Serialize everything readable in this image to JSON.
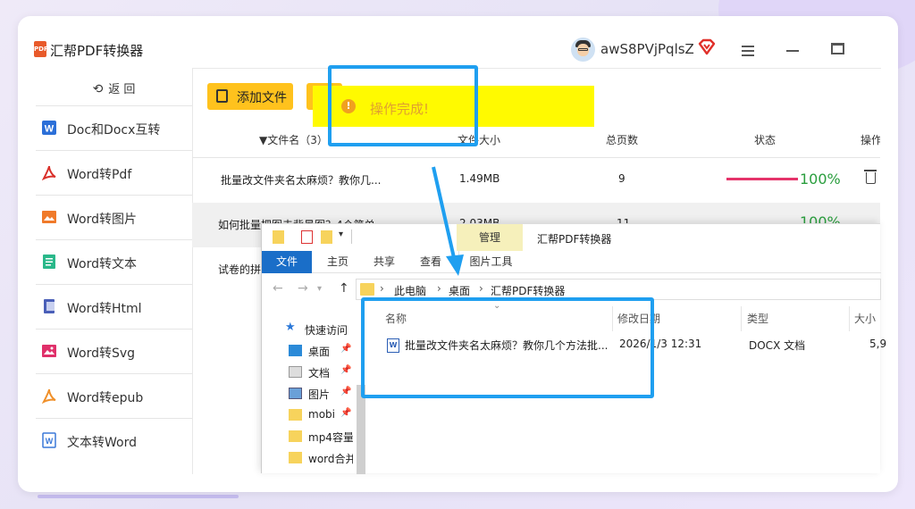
{
  "app": {
    "title": "汇帮PDF转换器",
    "logo_text": "PDF",
    "username": "awS8PVjPqlsZ"
  },
  "sidebar": {
    "back_label": "返  回",
    "items": [
      {
        "label": "Doc和Docx互转",
        "icon": "doc-w-icon",
        "color": "#2b6fd8"
      },
      {
        "label": "Word转Pdf",
        "icon": "pdf-icon",
        "color": "#d9302a"
      },
      {
        "label": "Word转图片",
        "icon": "image-icon",
        "color": "#f07a2a"
      },
      {
        "label": "Word转文本",
        "icon": "text-icon",
        "color": "#2ab88a"
      },
      {
        "label": "Word转Html",
        "icon": "html-icon",
        "color": "#4a5fb8"
      },
      {
        "label": "Word转Svg",
        "icon": "svg-image-icon",
        "color": "#e0306a"
      },
      {
        "label": "Word转epub",
        "icon": "epub-icon",
        "color": "#f0902a"
      },
      {
        "label": "文本转Word",
        "icon": "word-icon",
        "color": "#3a78d8"
      }
    ]
  },
  "toolbar": {
    "add_file_label": "添加文件",
    "toast_text": "操作完成!"
  },
  "table": {
    "headers": {
      "filename": "文件名（3）",
      "size": "文件大小",
      "pages": "总页数",
      "status": "状态",
      "action": "操作"
    },
    "rows": [
      {
        "name": "批量改文件夹名太麻烦？教你几...",
        "size": "1.49MB",
        "pages": "9",
        "progress": "100%"
      },
      {
        "name": "如何批量把图去背景图？4个简单",
        "size": "2.03MB",
        "pages": "11",
        "progress": "100%"
      },
      {
        "name": "试卷的拼"
      }
    ]
  },
  "explorer": {
    "manage_tab": "管理",
    "title": "汇帮PDF转换器",
    "tabs": [
      "文件",
      "主页",
      "共享",
      "查看",
      "图片工具"
    ],
    "breadcrumb": [
      "此电脑",
      "桌面",
      "汇帮PDF转换器"
    ],
    "nav": [
      {
        "label": "快速访问",
        "icon": "star-icon"
      },
      {
        "label": "桌面",
        "icon": "desktop-icon"
      },
      {
        "label": "文档",
        "icon": "document-icon"
      },
      {
        "label": "图片",
        "icon": "picture-icon"
      },
      {
        "label": "mobi",
        "icon": "folder-icon"
      },
      {
        "label": "mp4容量",
        "icon": "folder-icon"
      },
      {
        "label": "word合并",
        "icon": "folder-icon"
      }
    ],
    "columns": {
      "name": "名称",
      "modified": "修改日期",
      "type": "类型",
      "size": "大小"
    },
    "files": [
      {
        "name": "批量改文件夹名太麻烦？教你几个方法批...",
        "modified": "2026/1/3 12:31",
        "type": "DOCX 文档",
        "size": "5,9"
      }
    ]
  }
}
